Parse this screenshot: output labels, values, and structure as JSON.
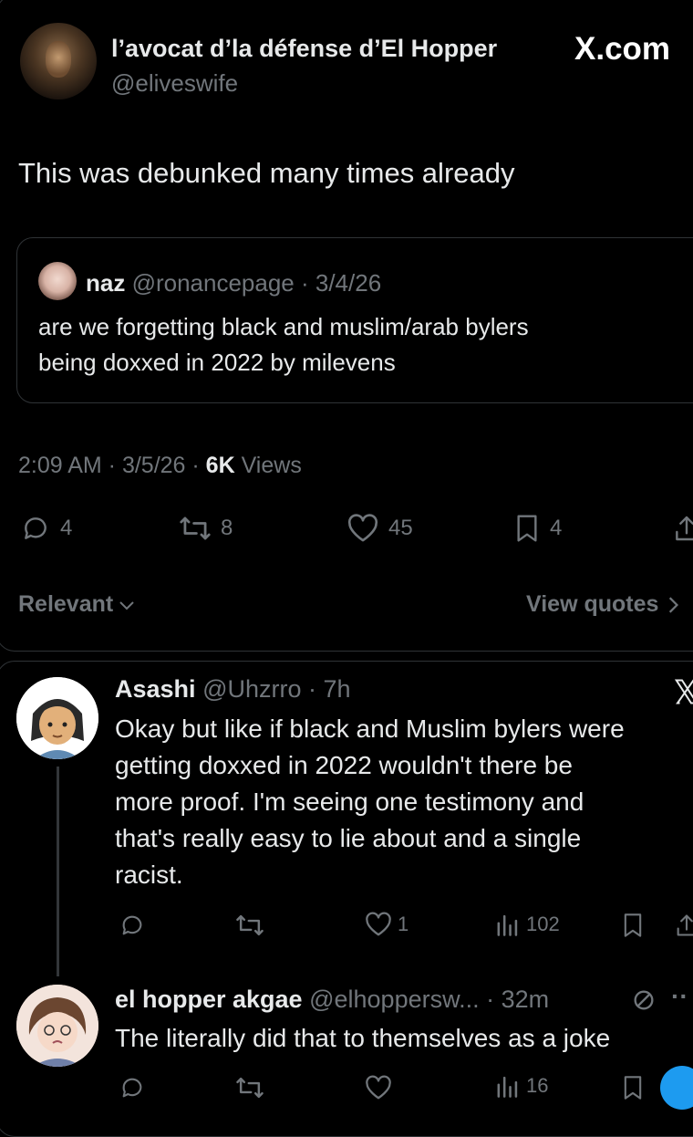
{
  "main_tweet": {
    "display_name": "l’avocat d’la défense d’El Hopper",
    "handle": "@eliveswife",
    "site_label": "X.com",
    "text": "This was debunked many times already",
    "quoted": {
      "name": "naz",
      "handle_date": "@ronancepage · 3/4/26",
      "text_line1": "are we forgetting black and muslim/arab bylers",
      "text_line2": "being doxxed in 2022 by milevens"
    },
    "meta_time": "2:09 AM · 3/5/26 · ",
    "meta_views_count": "6K",
    "meta_views_label": " Views",
    "stats": {
      "replies": "4",
      "reposts": "8",
      "likes": "45",
      "bookmarks": "4"
    },
    "sort_label": "Relevant",
    "view_quotes_label": "View quotes"
  },
  "replies": [
    {
      "display_name": "Asashi",
      "handle_time": "@Uhzrro · 7h",
      "lines": [
        "Okay but like if black and Muslim bylers were",
        "getting doxxed in 2022 wouldn't there be",
        "more proof. I'm seeing one testimony and",
        "that's really easy to lie about and a single",
        "racist."
      ],
      "likes": "1",
      "views": "102"
    },
    {
      "display_name": "el hopper akgae",
      "handle_time": "@elhoppersw... · 32m",
      "lines": [
        "The literally did that to themselves as a joke"
      ],
      "views": "16"
    }
  ],
  "colors": {
    "background": "#000000",
    "text": "#e7e9ea",
    "muted": "#71767b",
    "border": "#2f3336",
    "accent": "#1d9bf0"
  }
}
